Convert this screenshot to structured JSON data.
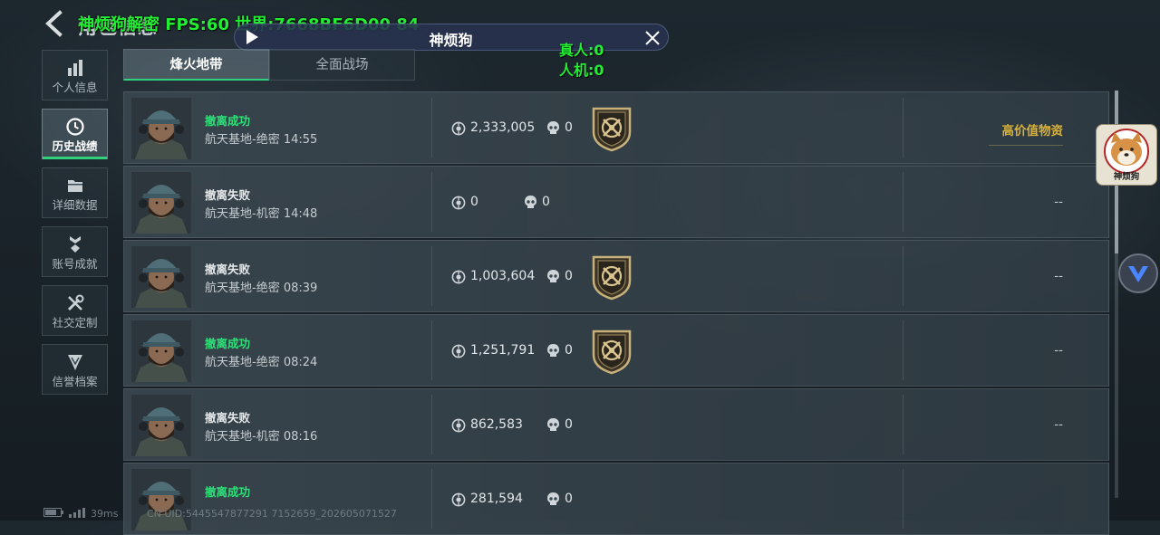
{
  "header": {
    "page_title": "角色信息",
    "overlay_title": "神烦狗解密  FPS:60 世界:7668BF6D00 84"
  },
  "floating_bar": {
    "title": "神烦狗",
    "real_players": "真人:0",
    "bots": "人机:0"
  },
  "sidebar": {
    "items": [
      {
        "label": "个人信息",
        "icon": "bar-chart-icon",
        "active": false
      },
      {
        "label": "历史战绩",
        "icon": "clock-icon",
        "active": true
      },
      {
        "label": "详细数据",
        "icon": "folder-icon",
        "active": false
      },
      {
        "label": "账号成就",
        "icon": "achievement-icon",
        "active": false
      },
      {
        "label": "社交定制",
        "icon": "tools-icon",
        "active": false
      },
      {
        "label": "信誉档案",
        "icon": "shield-icon",
        "active": false
      }
    ]
  },
  "tabs": [
    {
      "label": "烽火地带",
      "active": true
    },
    {
      "label": "全面战场",
      "active": false
    }
  ],
  "records": [
    {
      "status": "撤离成功",
      "success": true,
      "map": "航天基地-绝密 14:55",
      "value": "2,333,005",
      "kills": "0",
      "badge": true,
      "loot": "高价值物资"
    },
    {
      "status": "撤离失败",
      "success": false,
      "map": "航天基地-机密 14:48",
      "value": "0",
      "kills": "0",
      "badge": false,
      "loot": "--"
    },
    {
      "status": "撤离失败",
      "success": false,
      "map": "航天基地-绝密 08:39",
      "value": "1,003,604",
      "kills": "0",
      "badge": true,
      "loot": "--"
    },
    {
      "status": "撤离成功",
      "success": true,
      "map": "航天基地-绝密 08:24",
      "value": "1,251,791",
      "kills": "0",
      "badge": true,
      "loot": "--"
    },
    {
      "status": "撤离失败",
      "success": false,
      "map": "航天基地-机密 08:16",
      "value": "862,583",
      "kills": "0",
      "badge": false,
      "loot": "--"
    },
    {
      "status": "撤离成功",
      "success": true,
      "map": "",
      "value": "281,594",
      "kills": "0",
      "badge": false,
      "loot": ""
    }
  ],
  "side_widget": {
    "name": "神烦狗"
  },
  "footer": {
    "ping": "39ms",
    "uid": "CN UID:5445547877291 7152659_202605071527"
  },
  "colors": {
    "accent_green": "#2fd17a",
    "success_text": "#2fe07a",
    "overlay_green": "#22ee33",
    "loot_gold": "#d8b13a"
  }
}
